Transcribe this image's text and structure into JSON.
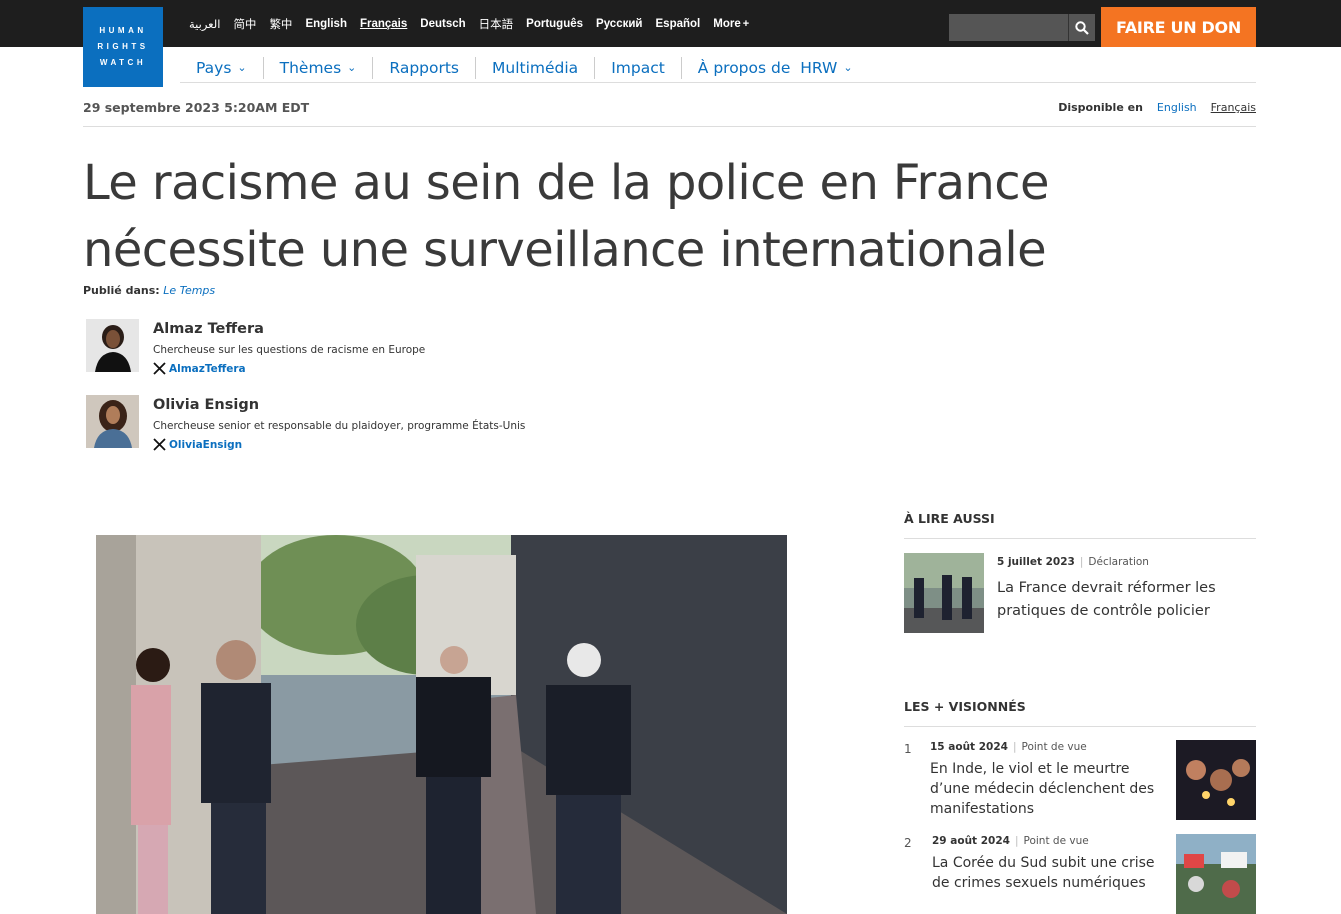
{
  "header": {
    "logo_lines": [
      "HUMAN",
      "RIGHTS",
      "WATCH"
    ],
    "languages": [
      {
        "label": "العربية",
        "active": false
      },
      {
        "label": "简中",
        "active": false
      },
      {
        "label": "繁中",
        "active": false
      },
      {
        "label": "English",
        "active": false
      },
      {
        "label": "Français",
        "active": true
      },
      {
        "label": "Deutsch",
        "active": false
      },
      {
        "label": "日本語",
        "active": false
      },
      {
        "label": "Português",
        "active": false
      },
      {
        "label": "Русский",
        "active": false
      },
      {
        "label": "Español",
        "active": false
      }
    ],
    "more_label": "More",
    "more_plus": "+",
    "search_placeholder": "",
    "donate_label": "FAIRE UN DON"
  },
  "nav": {
    "items": [
      {
        "label": "Pays",
        "dropdown": true
      },
      {
        "label": "Thèmes",
        "dropdown": true
      },
      {
        "label": "Rapports",
        "dropdown": false
      },
      {
        "label": "Multimédia",
        "dropdown": false
      },
      {
        "label": "Impact",
        "dropdown": false
      },
      {
        "label": "À propos de  HRW",
        "dropdown": true
      }
    ]
  },
  "article": {
    "date": "29 septembre 2023 5:20AM EDT",
    "available_label": "Disponible en",
    "available_langs": [
      "English",
      "Français"
    ],
    "title": "Le racisme au sein de la police en France nécessite une surveillance internationale",
    "published_label": "Publié dans:",
    "published_in": "Le Temps",
    "authors": [
      {
        "name": "Almaz Teffera",
        "role": "Chercheuse sur les questions de racisme en Europe",
        "handle": "AlmazTeffera"
      },
      {
        "name": "Olivia Ensign",
        "role": "Chercheuse senior et responsable du plaidoyer, programme États-Unis",
        "handle": "OliviaEnsign"
      }
    ]
  },
  "sidebar": {
    "read_also_title": "À LIRE AUSSI",
    "read_also": {
      "date": "5 juillet 2023",
      "type": "Déclaration",
      "title": "La France devrait réformer les pratiques de contrôle policier"
    },
    "most_viewed_title": "LES + VISIONNÉS",
    "most_viewed": [
      {
        "rank": "1",
        "date": "15 août 2024",
        "type": "Point de vue",
        "title": "En Inde, le viol et le meurtre d’une médecin déclenchent des manifestations"
      },
      {
        "rank": "2",
        "date": "29 août 2024",
        "type": "Point de vue",
        "title": "La Corée du Sud subit une crise de crimes sexuels numériques"
      }
    ]
  },
  "colors": {
    "brand_blue": "#0b6fbf",
    "donate_orange": "#f47422",
    "topbar": "#1e1e1e"
  }
}
